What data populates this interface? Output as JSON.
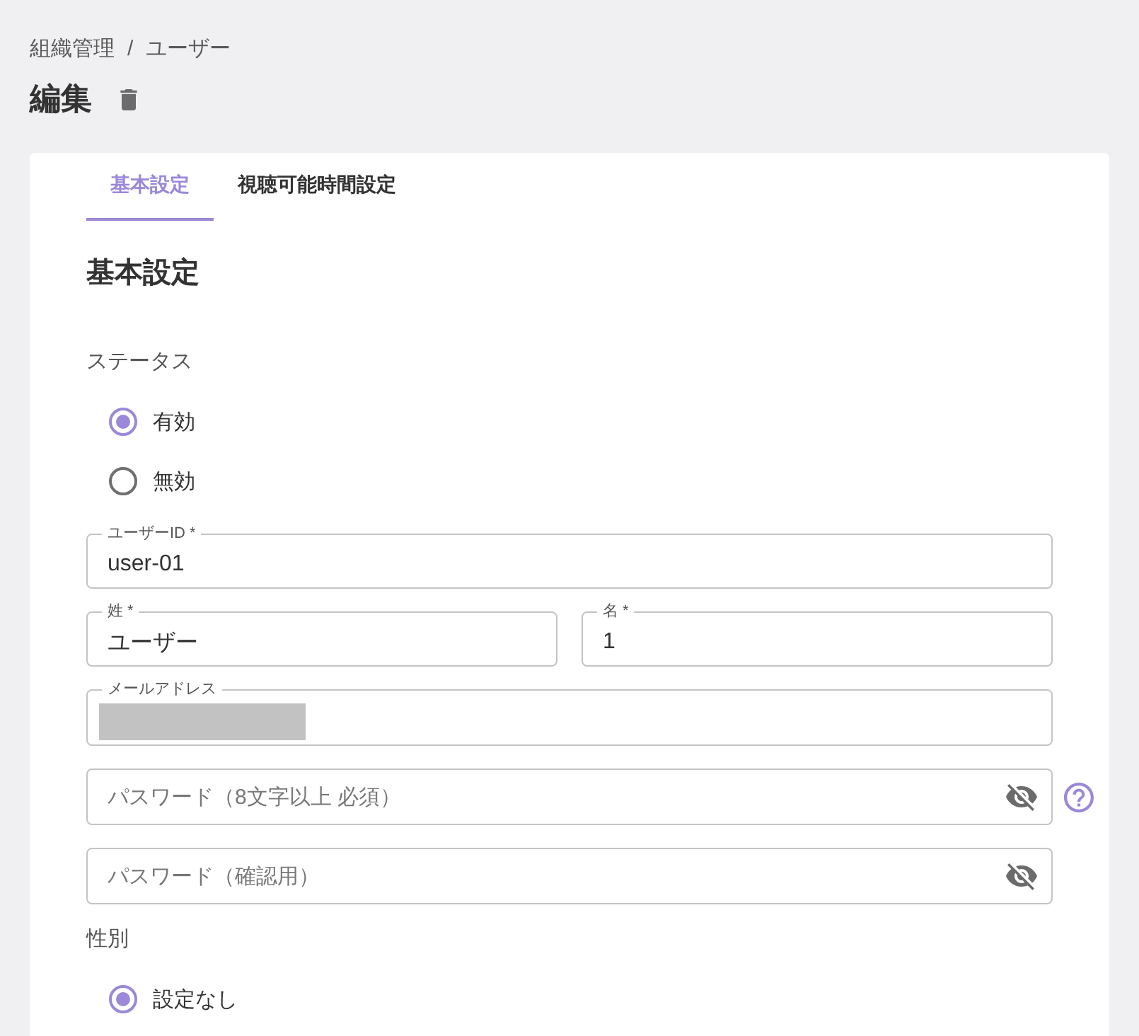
{
  "breadcrumb": {
    "items": [
      {
        "label": "組織管理"
      },
      {
        "label": "ユーザー"
      }
    ],
    "separator": "/"
  },
  "page_title": "編集",
  "tabs": [
    {
      "label": "基本設定",
      "selected": true
    },
    {
      "label": "視聴可能時間設定",
      "selected": false
    }
  ],
  "section_title": "基本設定",
  "form": [
    {
      "kind": "radio_group",
      "label": "ステータス",
      "options": [
        {
          "label": "有効",
          "selected": true
        },
        {
          "label": "無効",
          "selected": false
        }
      ]
    },
    {
      "kind": "text",
      "label": "ユーザーID *",
      "value": "user-01"
    },
    {
      "kind": "text_pair",
      "fields": [
        {
          "label": "姓 *",
          "value": "ユーザー"
        },
        {
          "label": "名 *",
          "value": "1"
        }
      ]
    },
    {
      "kind": "text",
      "label": "メールアドレス",
      "value_redacted": true
    },
    {
      "kind": "password",
      "placeholder": "パスワード（8文字以上 必須）",
      "visible": false,
      "help": true
    },
    {
      "kind": "password",
      "placeholder": "パスワード（確認用）",
      "visible": false,
      "help": false
    },
    {
      "kind": "radio_group",
      "label": "性別",
      "options": [
        {
          "label": "設定なし",
          "selected": true
        }
      ]
    }
  ]
}
